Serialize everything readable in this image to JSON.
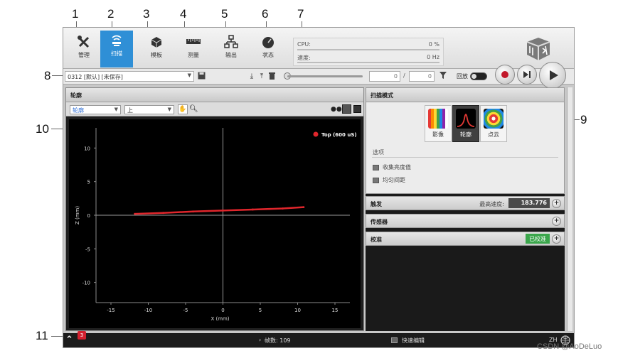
{
  "callouts": [
    "1",
    "2",
    "3",
    "4",
    "5",
    "6",
    "7",
    "8",
    "9",
    "10",
    "11"
  ],
  "nav": [
    {
      "label": "管理",
      "icon": "tools-icon"
    },
    {
      "label": "扫描",
      "icon": "scan-icon",
      "active": true
    },
    {
      "label": "模板",
      "icon": "model-icon"
    },
    {
      "label": "测量",
      "icon": "measure-icon"
    },
    {
      "label": "输出",
      "icon": "output-icon"
    },
    {
      "label": "状态",
      "icon": "dashboard-icon"
    }
  ],
  "perf": {
    "cpu_label": "CPU:",
    "cpu_value": "0 %",
    "speed_label": "速度:",
    "speed_value": "0 Hz"
  },
  "toolbar": {
    "job": "0312 [默认] [未保存]",
    "frame_current": "0",
    "frame_sep": "/",
    "frame_total": "0",
    "replay_label": "回放"
  },
  "left_panel": {
    "title": "轮廓",
    "view_select": "轮廓",
    "side_select": "上",
    "legend": "Top (600 uS)"
  },
  "right_panel": {
    "title": "扫描模式",
    "modes": [
      {
        "label": "影像",
        "icon": "video-icon"
      },
      {
        "label": "轮廓",
        "icon": "profile-icon",
        "active": true
      },
      {
        "label": "点云",
        "icon": "surface-icon"
      }
    ],
    "options_title": "选项",
    "options": [
      "收集亮度值",
      "均匀间距"
    ],
    "sections": [
      {
        "label": "触发",
        "extra_label": "最高速度:",
        "extra_value": "183.776"
      },
      {
        "label": "传感器"
      },
      {
        "label": "校准",
        "badge": "已校准"
      }
    ]
  },
  "status": {
    "badge": "3",
    "frames": "帧数: 109",
    "quick_edit": "快速编辑",
    "lang": "ZH"
  },
  "watermark": "CSDN @AoDeLuo",
  "chart_data": {
    "type": "line",
    "title": "",
    "xlabel": "X (mm)",
    "ylabel": "Z (mm)",
    "xlim": [
      -17,
      17
    ],
    "ylim": [
      -13,
      13
    ],
    "xticks": [
      -15,
      -10,
      -5,
      0,
      5,
      10,
      15
    ],
    "yticks": [
      10,
      5,
      0,
      -5,
      -10
    ],
    "grid": false,
    "legend": "top-right",
    "series": [
      {
        "name": "Top (600 uS)",
        "color": "#e0262c",
        "x": [
          -11.8,
          -8,
          -4,
          0,
          4,
          8,
          10.8
        ],
        "y": [
          0.2,
          0.35,
          0.55,
          0.7,
          0.85,
          1.0,
          1.2
        ]
      }
    ]
  }
}
